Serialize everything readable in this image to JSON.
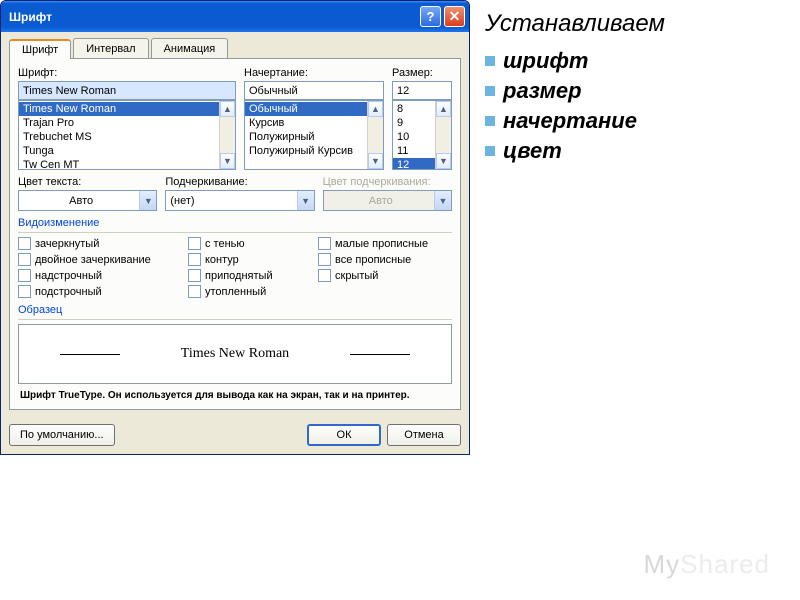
{
  "window": {
    "title": "Шрифт"
  },
  "tabs": [
    {
      "label": "Шрифт",
      "active": true
    },
    {
      "label": "Интервал",
      "active": false
    },
    {
      "label": "Анимация",
      "active": false
    }
  ],
  "labels": {
    "font": "Шрифт:",
    "style": "Начертание:",
    "size": "Размер:",
    "text_color": "Цвет текста:",
    "underline": "Подчеркивание:",
    "underline_color": "Цвет подчеркивания:",
    "effects": "Видоизменение",
    "sample": "Образец"
  },
  "fields": {
    "font_value": "Times New Roman",
    "style_value": "Обычный",
    "size_value": "12",
    "text_color_value": "Авто",
    "underline_value": "(нет)",
    "underline_color_value": "Авто"
  },
  "font_list": [
    "Times New Roman",
    "Trajan Pro",
    "Trebuchet MS",
    "Tunga",
    "Tw Cen MT"
  ],
  "font_selected": "Times New Roman",
  "style_list": [
    "Обычный",
    "Курсив",
    "Полужирный",
    "Полужирный Курсив"
  ],
  "style_selected": "Обычный",
  "size_list": [
    "8",
    "9",
    "10",
    "11",
    "12"
  ],
  "size_selected": "12",
  "effects": {
    "col1": [
      "зачеркнутый",
      "двойное зачеркивание",
      "надстрочный",
      "подстрочный"
    ],
    "col2": [
      "с тенью",
      "контур",
      "приподнятый",
      "утопленный"
    ],
    "col3": [
      "малые прописные",
      "все прописные",
      "скрытый"
    ]
  },
  "preview_text": "Times New Roman",
  "hint": "Шрифт TrueType. Он используется для вывода как на экран, так и на принтер.",
  "buttons": {
    "default": "По умолчанию...",
    "ok": "ОК",
    "cancel": "Отмена"
  },
  "slide": {
    "title": "Устанавливаем",
    "items": [
      "шрифт",
      "размер",
      "начертание",
      "цвет"
    ]
  },
  "watermark": {
    "a": "My",
    "b": "Shared"
  }
}
